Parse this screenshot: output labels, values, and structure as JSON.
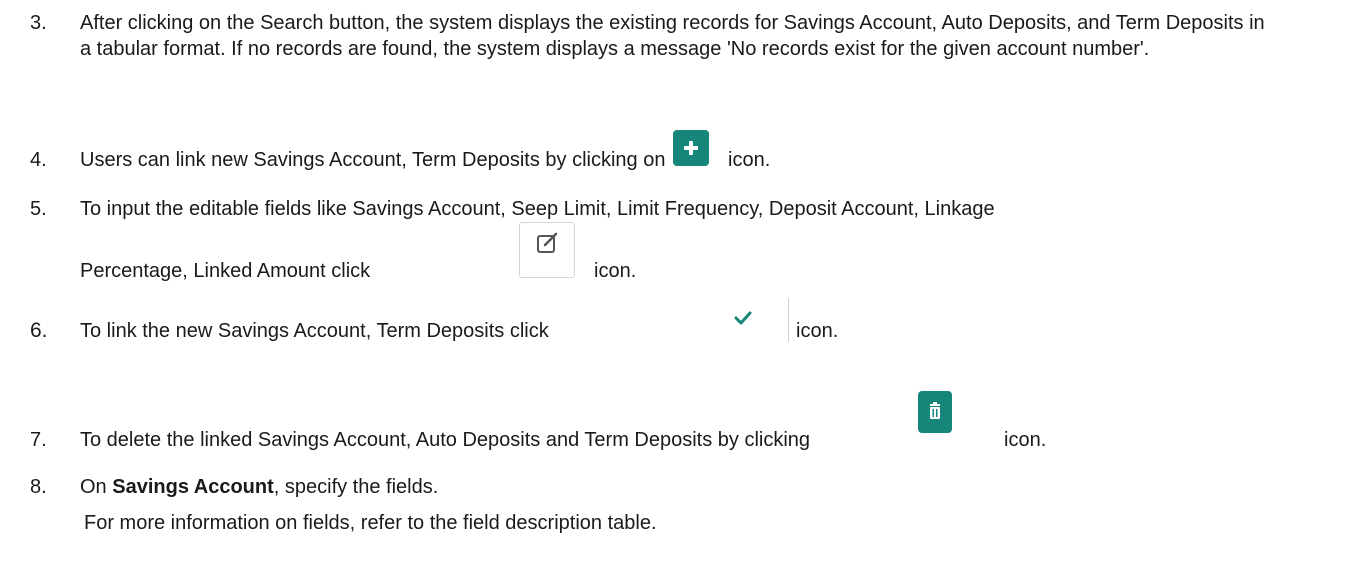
{
  "steps": [
    {
      "num": "3.",
      "text": "After clicking on the Search button, the system displays the existing records for Savings Account, Auto Deposits, and Term Deposits in a tabular format. If no records are found, the system displays a message 'No records exist for the given account number'."
    },
    {
      "num": "4.",
      "before": "Users can link new Savings Account, Term Deposits by clicking on",
      "icon": "plus-icon",
      "after": "icon."
    },
    {
      "num": "5.",
      "line1": "To input the editable fields like Savings Account, Seep Limit, Limit Frequency, Deposit Account, Linkage",
      "before": "Percentage, Linked Amount click",
      "icon": "edit-icon",
      "after": "icon."
    },
    {
      "num": "6.",
      "before": "To link the new Savings Account, Term Deposits click",
      "icon": "check-icon",
      "after": "icon."
    },
    {
      "num": "7.",
      "before": "To delete the linked Savings Account, Auto Deposits and Term Deposits by clicking",
      "icon": "trash-icon",
      "after": "icon."
    },
    {
      "num": "8.",
      "prefix": "On",
      "bold": "Savings Account",
      "suffix": ", specify the fields.",
      "note": "For more information on fields, refer to the field description table."
    }
  ],
  "colors": {
    "accent": "#16857a",
    "text": "#1a1a1a",
    "border": "#d6d6d6"
  }
}
